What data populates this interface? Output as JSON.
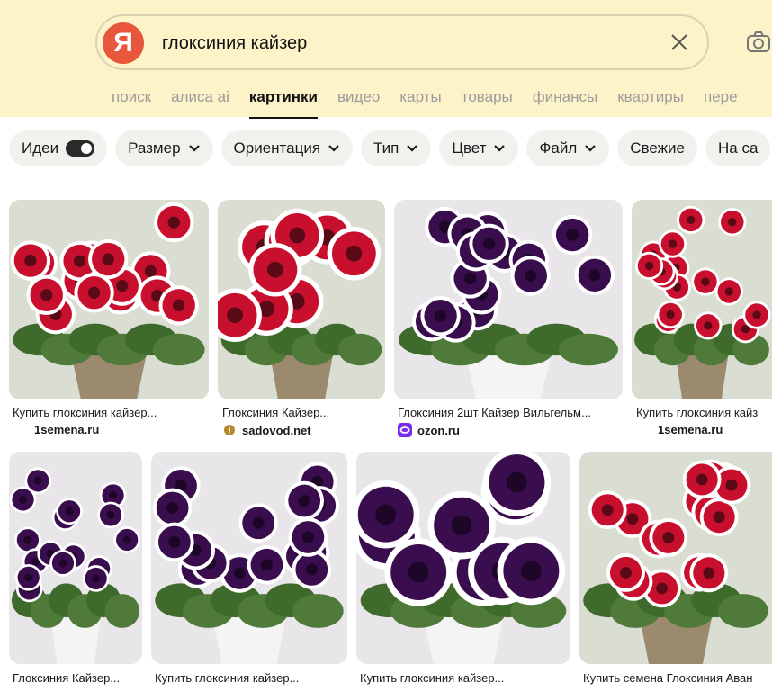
{
  "search": {
    "logo_letter": "Я",
    "query": "глоксиния кайзер"
  },
  "tabs": [
    {
      "label": "поиск"
    },
    {
      "label": "алиса ai"
    },
    {
      "label": "картинки"
    },
    {
      "label": "видео"
    },
    {
      "label": "карты"
    },
    {
      "label": "товары"
    },
    {
      "label": "финансы"
    },
    {
      "label": "квартиры"
    },
    {
      "label": "пере"
    }
  ],
  "active_tab": "картинки",
  "filters": [
    {
      "label": "Идеи"
    },
    {
      "label": "Размер"
    },
    {
      "label": "Ориентация"
    },
    {
      "label": "Тип"
    },
    {
      "label": "Цвет"
    },
    {
      "label": "Файл"
    },
    {
      "label": "Свежие"
    },
    {
      "label": "На са"
    }
  ],
  "results": [
    {
      "caption": "Купить глоксиния кайзер...",
      "source": "1semena.ru",
      "flower": "red"
    },
    {
      "caption": "Глоксиния Кайзер...",
      "source": "sadovod.net",
      "flower": "red-big"
    },
    {
      "caption": "Глоксиния 2шт Кайзер Вильгельм...",
      "source": "ozon.ru",
      "flower": "purple"
    },
    {
      "caption": "Купить глоксиния кайз",
      "source": "1semena.ru",
      "flower": "red"
    },
    {
      "caption": "Глоксиния Кайзер...",
      "source": "",
      "flower": "purple"
    },
    {
      "caption": "Купить глоксиния кайзер...",
      "source": "",
      "flower": "purple"
    },
    {
      "caption": "Купить глоксиния кайзер...",
      "source": "",
      "flower": "purple-big"
    },
    {
      "caption": "Купить семена Глоксиния Аван",
      "source": "",
      "flower": "red"
    }
  ],
  "colors": {
    "header_bg": "#fdf3c9",
    "logo_red": "#e8563b",
    "red_petal": "#c8102e",
    "purple_petal": "#3a0d4f",
    "leaf": "#4f7a3a"
  }
}
